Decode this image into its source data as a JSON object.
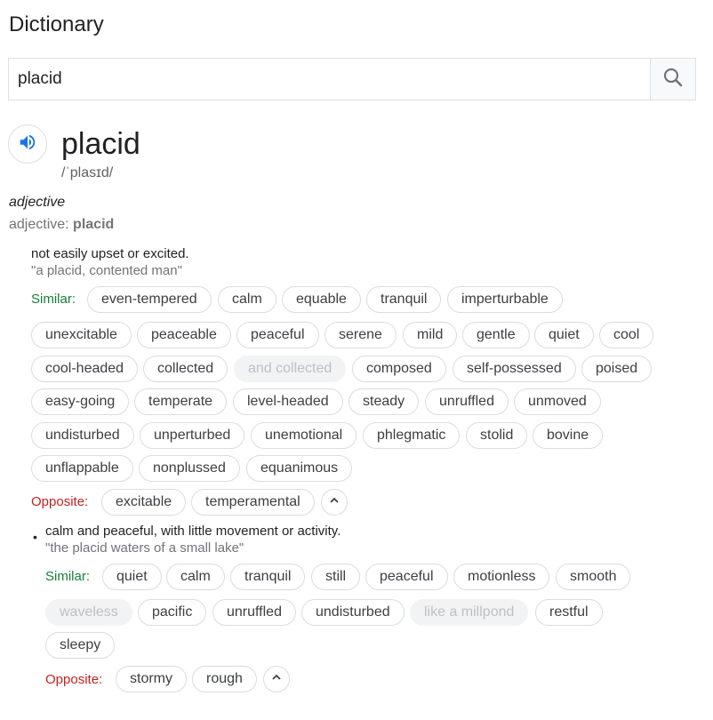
{
  "app": {
    "title": "Dictionary"
  },
  "search": {
    "value": "placid",
    "icon": "search-icon"
  },
  "entry": {
    "word": "placid",
    "phonetic": "/ˈplasɪd/",
    "part_of_speech": "adjective",
    "forms_prefix": "adjective: ",
    "forms_word": "placid"
  },
  "labels": {
    "similar": "Similar:",
    "opposite": "Opposite:",
    "bullet": "•"
  },
  "senses": [
    {
      "definition": "not easily upset or excited.",
      "example": "\"a placid, contented man\"",
      "similar": [
        "even-tempered",
        "calm",
        "equable",
        "tranquil",
        "imperturbable",
        "unexcitable",
        "peaceable",
        "peaceful",
        "serene",
        "mild",
        "gentle",
        "quiet",
        "cool",
        "cool-headed",
        "collected",
        "and collected",
        "composed",
        "self-possessed",
        "poised",
        "easy-going",
        "temperate",
        "level-headed",
        "steady",
        "unruffled",
        "unmoved",
        "undisturbed",
        "unperturbed",
        "unemotional",
        "phlegmatic",
        "stolid",
        "bovine",
        "unflappable",
        "nonplussed",
        "equanimous"
      ],
      "opposite": [
        "excitable",
        "temperamental"
      ]
    },
    {
      "definition": "calm and peaceful, with little movement or activity.",
      "example": "\"the placid waters of a small lake\"",
      "similar": [
        "quiet",
        "calm",
        "tranquil",
        "still",
        "peaceful",
        "motionless",
        "smooth",
        "waveless",
        "pacific",
        "unruffled",
        "undisturbed",
        "like a millpond",
        "restful",
        "sleepy"
      ],
      "opposite": [
        "stormy",
        "rough"
      ]
    }
  ],
  "colors": {
    "similar": "#188038",
    "opposite": "#c5221f",
    "accent": "#1a73e8"
  }
}
